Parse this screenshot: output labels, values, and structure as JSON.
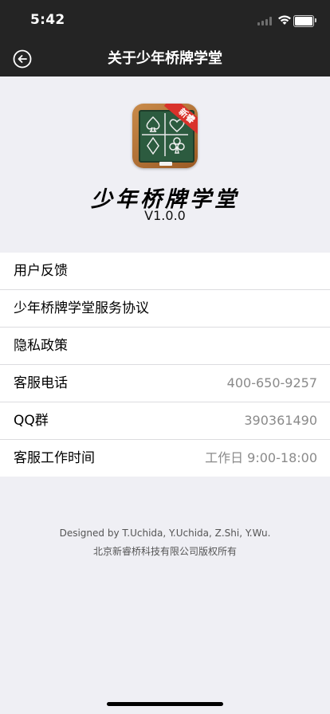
{
  "status_bar": {
    "time": "5:42"
  },
  "nav": {
    "title": "关于少年桥牌学堂",
    "back_icon": "back-arrow-circle-icon"
  },
  "app": {
    "name": "少年桥牌学堂",
    "version": "V1.0.0",
    "badge": "新睿",
    "icon": "bridge-cards-board-icon"
  },
  "list": [
    {
      "label": "用户反馈",
      "value": ""
    },
    {
      "label": "少年桥牌学堂服务协议",
      "value": ""
    },
    {
      "label": "隐私政策",
      "value": ""
    },
    {
      "label": "客服电话",
      "value": "400-650-9257"
    },
    {
      "label": "QQ群",
      "value": "390361490"
    },
    {
      "label": "客服工作时间",
      "value": "工作日 9:00-18:00"
    }
  ],
  "footer": {
    "credits": "Designed by T.Uchida, Y.Uchida, Z.Shi, Y.Wu.",
    "copyright": "北京新睿桥科技有限公司版权所有"
  },
  "colors": {
    "nav_bg": "#242424",
    "page_bg": "#efeff4",
    "badge_red": "#d9322b",
    "board_green": "#2c5b3f"
  }
}
